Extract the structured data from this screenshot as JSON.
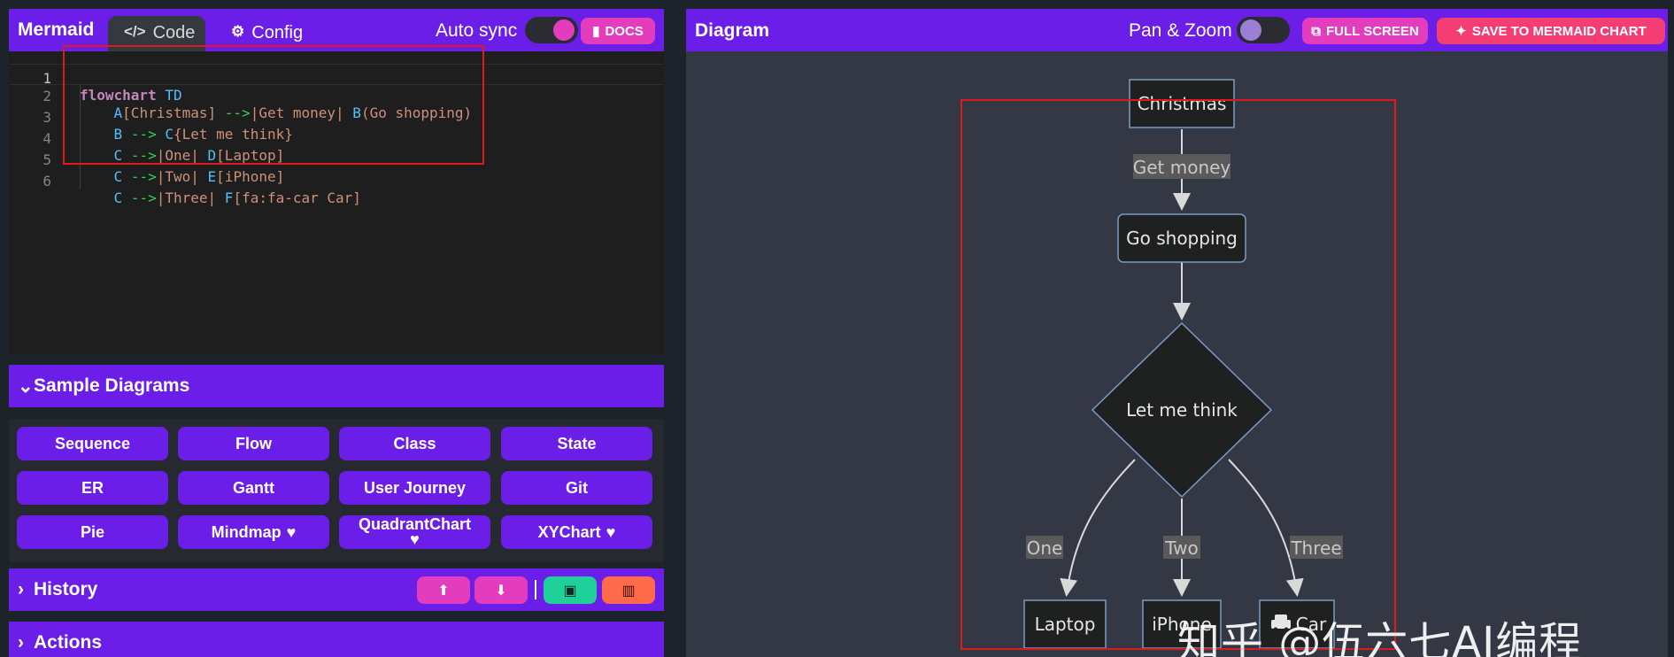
{
  "left": {
    "app_title": "Mermaid",
    "tabs": [
      {
        "label": "Code",
        "icon": "code-icon"
      },
      {
        "label": "Config",
        "icon": "gears-icon"
      }
    ],
    "auto_sync_label": "Auto sync",
    "auto_sync_on": true,
    "docs_label": "DOCS",
    "editor": {
      "line_numbers": [
        "1",
        "2",
        "3",
        "4",
        "5",
        "6"
      ],
      "lines": [
        "flowchart TD",
        "A[Christmas] -->|Get money| B(Go shopping)",
        "B --> C{Let me think}",
        "C -->|One| D[Laptop]",
        "C -->|Two| E[iPhone]",
        "C -->|Three| F[fa:fa-car Car]"
      ]
    },
    "sample_diagrams": {
      "title": "Sample Diagrams",
      "buttons": [
        "Sequence",
        "Flow",
        "Class",
        "State",
        "ER",
        "Gantt",
        "User Journey",
        "Git",
        "Pie",
        "Mindmap",
        "QuadrantChart",
        "XYChart"
      ]
    },
    "history": {
      "title": "History"
    },
    "actions": {
      "title": "Actions"
    }
  },
  "right": {
    "title": "Diagram",
    "pan_zoom_label": "Pan & Zoom",
    "pan_zoom_on": false,
    "full_screen_label": "FULL SCREEN",
    "save_label": "SAVE TO MERMAID CHART",
    "diagram": {
      "nodes": {
        "a": "Christmas",
        "b": "Go shopping",
        "c": "Let me think",
        "d": "Laptop",
        "e": "iPhone",
        "f": "Car"
      },
      "edges": {
        "ab": "Get money",
        "cd": "One",
        "ce": "Two",
        "cf": "Three"
      }
    },
    "watermark": "知乎 @伍六七AI编程"
  },
  "colors": {
    "accent": "#6b1ee8",
    "pink": "#e33dbe",
    "save": "#f33d73",
    "highlight_box": "#e0191c"
  }
}
